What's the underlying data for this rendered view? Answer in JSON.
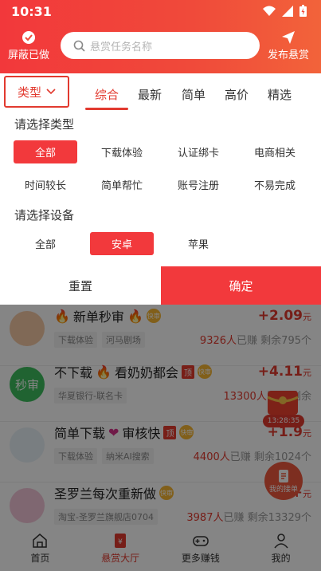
{
  "status": {
    "time": "10:31"
  },
  "header": {
    "block_label": "屏蔽已做",
    "search_placeholder": "悬赏任务名称",
    "publish_label": "发布悬赏"
  },
  "filter_tabs": {
    "type_label": "类型",
    "tabs": [
      "综合",
      "最新",
      "简单",
      "高价",
      "精选"
    ],
    "active_index": 0
  },
  "filter_panel": {
    "type_title": "请选择类型",
    "types": [
      "全部",
      "下载体验",
      "认证绑卡",
      "电商相关",
      "时间较长",
      "简单帮忙",
      "账号注册",
      "不易完成"
    ],
    "type_selected": 0,
    "device_title": "请选择设备",
    "devices": [
      "全部",
      "安卓",
      "苹果"
    ],
    "device_selected": 1,
    "reset_label": "重置",
    "confirm_label": "确定"
  },
  "tasks": [
    {
      "title": "新单秒审",
      "tags": [
        "下载体验",
        "河马剧场"
      ],
      "reward": "+2.09",
      "unit": "元",
      "earned": "9326人",
      "earned_suffix": "已赚",
      "remaining": "剩余795个"
    },
    {
      "title": "不下载",
      "title2": "看奶奶都会",
      "top": "顶",
      "tags": [
        "华夏银行-联名卡"
      ],
      "reward": "+4.11",
      "unit": "元",
      "earned": "13300人",
      "earned_suffix": "已赚",
      "remaining": "剩余"
    },
    {
      "title": "简单下载",
      "title2": "审核快",
      "top": "顶",
      "avatar_text": "秒审",
      "tags": [
        "下载体验",
        "纳米AI搜索"
      ],
      "reward": "+1.9",
      "unit": "元",
      "earned": "4400人",
      "earned_suffix": "已赚",
      "remaining": "剩余1024个"
    },
    {
      "title": "圣罗兰每次重新做",
      "tags": [
        "淘宝-圣罗兰旗舰店0704"
      ],
      "reward": "+",
      "unit": "元",
      "earned": "3987人",
      "earned_suffix": "已赚",
      "remaining": "剩余13329个"
    }
  ],
  "badge_q": "快审",
  "float": {
    "timer": "13:28:35",
    "my_orders": "我的接单"
  },
  "bottom_nav": [
    "首页",
    "悬赏大厅",
    "更多赚钱",
    "我的"
  ],
  "bottom_nav_active": 1,
  "colors": {
    "accent": "#f2393c"
  }
}
